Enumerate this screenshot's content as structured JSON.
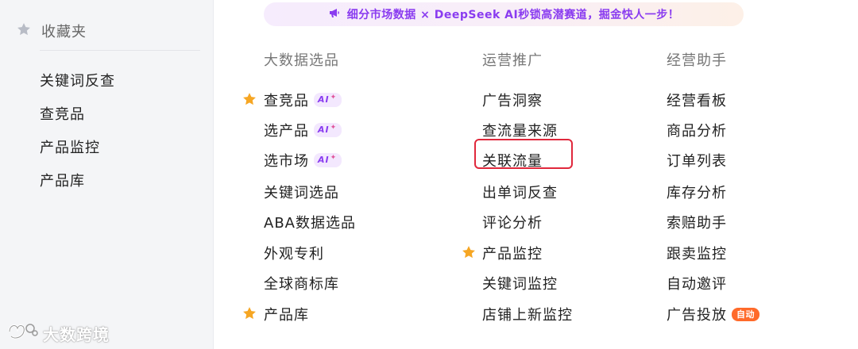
{
  "sidebar": {
    "favorites_label": "收藏夹",
    "items": [
      {
        "label": "关键词反查"
      },
      {
        "label": "查竞品"
      },
      {
        "label": "产品监控"
      },
      {
        "label": "产品库"
      }
    ]
  },
  "banner": {
    "text": "细分市场数据 × DeepSeek AI秒锁高潜赛道，掘金快人一步！",
    "icon": "megaphone-icon"
  },
  "columns": [
    {
      "header": "大数据选品",
      "items": [
        {
          "label": "查竞品",
          "starred": true,
          "badge": "AI"
        },
        {
          "label": "选产品",
          "starred": false,
          "badge": "AI"
        },
        {
          "label": "选市场",
          "starred": false,
          "badge": "AI"
        },
        {
          "label": "关键词选品",
          "starred": false
        },
        {
          "label": "ABA数据选品",
          "starred": false
        },
        {
          "label": "外观专利",
          "starred": false
        },
        {
          "label": "全球商标库",
          "starred": false
        },
        {
          "label": "产品库",
          "starred": true
        }
      ]
    },
    {
      "header": "运营推广",
      "items": [
        {
          "label": "广告洞察",
          "starred": false
        },
        {
          "label": "查流量来源",
          "starred": false
        },
        {
          "label": "关联流量",
          "starred": false,
          "highlighted": true
        },
        {
          "label": "出单词反查",
          "starred": false
        },
        {
          "label": "评论分析",
          "starred": false
        },
        {
          "label": "产品监控",
          "starred": true
        },
        {
          "label": "关键词监控",
          "starred": false
        },
        {
          "label": "店铺上新监控",
          "starred": false
        }
      ]
    },
    {
      "header": "经营助手",
      "items": [
        {
          "label": "经营看板"
        },
        {
          "label": "商品分析"
        },
        {
          "label": "订单列表"
        },
        {
          "label": "库存分析"
        },
        {
          "label": "索赔助手"
        },
        {
          "label": "跟卖监控"
        },
        {
          "label": "自动邀评"
        },
        {
          "label": "广告投放",
          "badge": "自动"
        }
      ]
    }
  ],
  "watermark": {
    "text": "大数跨境"
  },
  "colors": {
    "accent_purple": "#8a3cf0",
    "star": "#f6a623",
    "highlight": "#e0283c",
    "auto_badge": "#ff6a2a"
  }
}
